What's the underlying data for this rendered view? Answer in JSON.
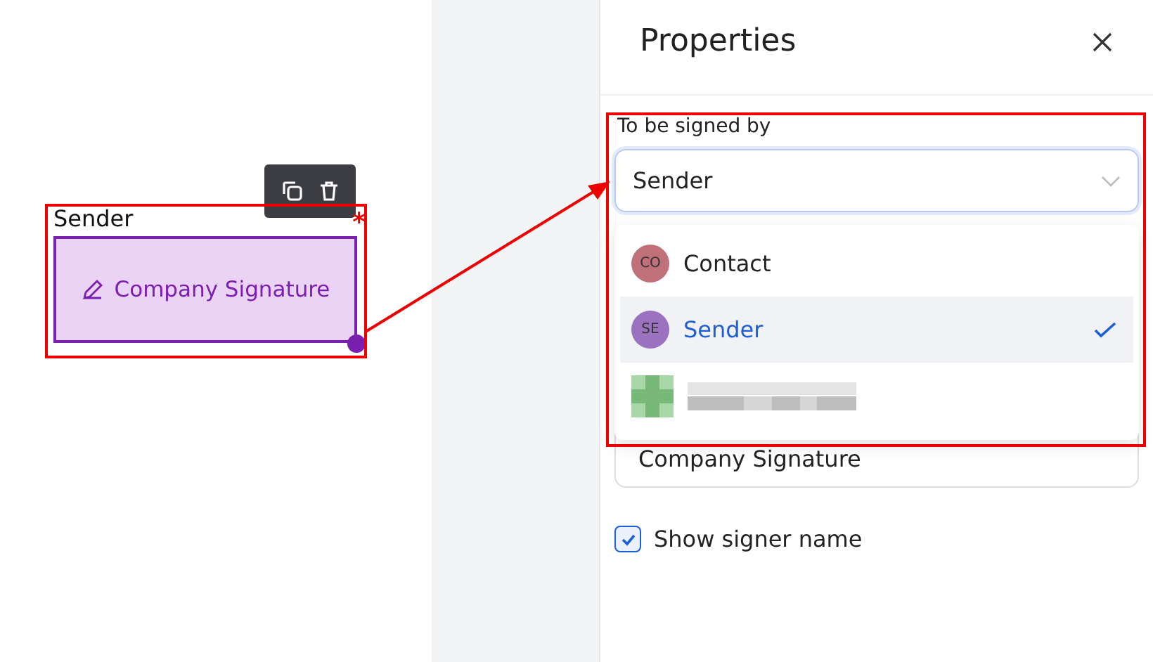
{
  "canvas": {
    "field": {
      "signer": "Sender",
      "label": "Company Signature",
      "required_mark": "*",
      "toolbar": true
    }
  },
  "panel": {
    "title": "Properties",
    "signed_by": {
      "label": "To be signed by",
      "value": "Sender",
      "expanded": true,
      "options": [
        {
          "kind": "person",
          "initials": "CO",
          "name": "Contact",
          "color": "#c07078",
          "selected": false
        },
        {
          "kind": "person",
          "initials": "SE",
          "name": "Sender",
          "color": "#9b72c0",
          "selected": true
        },
        {
          "kind": "redacted",
          "selected": false
        }
      ]
    },
    "field_name": {
      "value": "Company Signature"
    },
    "show_signer_name": {
      "label": "Show signer name",
      "checked": true
    }
  },
  "annotations": {
    "highlight": true
  }
}
